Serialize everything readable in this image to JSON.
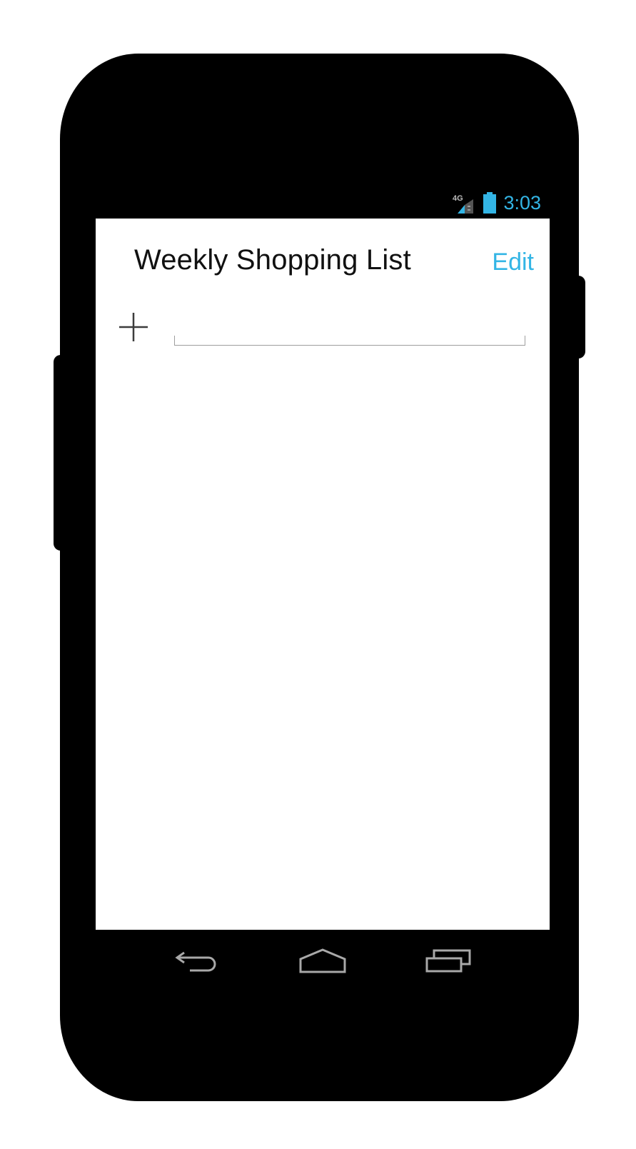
{
  "status_bar": {
    "network_type": "4G",
    "time": "3:03",
    "accent_color": "#33b5e5"
  },
  "app": {
    "title": "Weekly Shopping List",
    "edit_label": "Edit"
  },
  "add_item": {
    "icon": "plus-icon",
    "input_value": "",
    "input_placeholder": ""
  },
  "nav_bar": {
    "icons": [
      "back-icon",
      "home-icon",
      "recent-apps-icon"
    ]
  }
}
